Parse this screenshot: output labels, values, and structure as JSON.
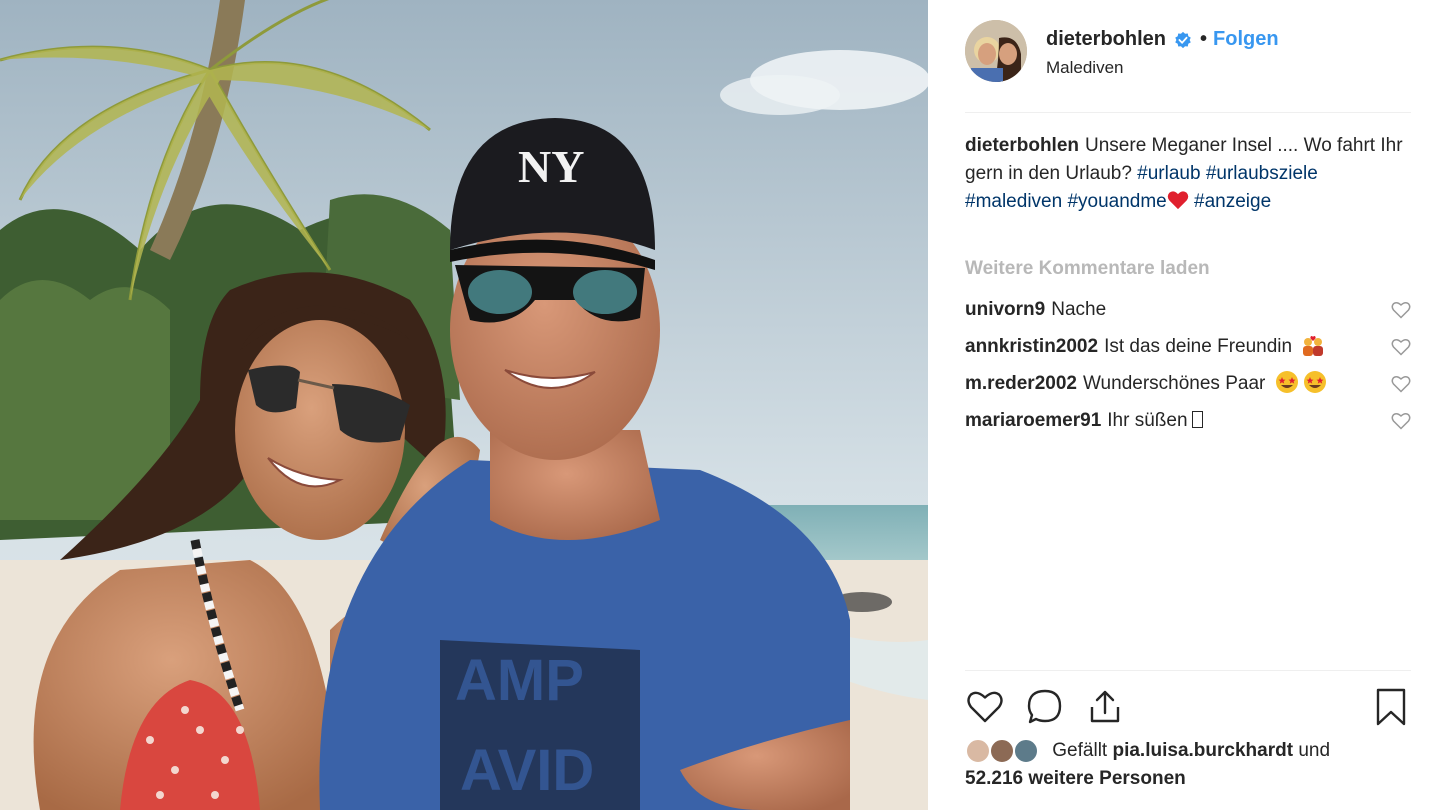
{
  "post": {
    "username": "dieterbohlen",
    "verified": true,
    "follow_label": "Folgen",
    "separator": "•",
    "location": "Malediven",
    "avatar_icon": "profile-photo"
  },
  "caption": {
    "username": "dieterbohlen",
    "text": "Unsere Meganer Insel .... Wo fahrt Ihr gern in den Urlaub?",
    "hashtags": [
      "#urlaub",
      "#urlaubsziele",
      "#malediven",
      "#youandme",
      "#anzeige"
    ],
    "emoji": "red-heart"
  },
  "load_more_label": "Weitere Kommentare laden",
  "comments": [
    {
      "username": "univorn9",
      "text": "Nache"
    },
    {
      "username": "annkristin2002",
      "text": "Ist das deine Freundin",
      "emoji": "couple-with-heart"
    },
    {
      "username": "m.reder2002",
      "text": "Wunderschönes Paar",
      "emoji": "star-struck x2"
    },
    {
      "username": "mariaroemer91",
      "text": "Ihr süßen",
      "glyph": "missing-glyph-box"
    }
  ],
  "actions": [
    "heart-icon",
    "comment-icon",
    "share-icon",
    "bookmark-icon"
  ],
  "likes": {
    "prefix": "Gefällt",
    "user": "pia.luisa.burckhardt",
    "connector": "und",
    "count_text": "52.216 weitere Personen"
  },
  "colors": {
    "link": "#3897f0",
    "hashtag": "#003569",
    "muted": "#b8b8b8",
    "text": "#262626"
  }
}
